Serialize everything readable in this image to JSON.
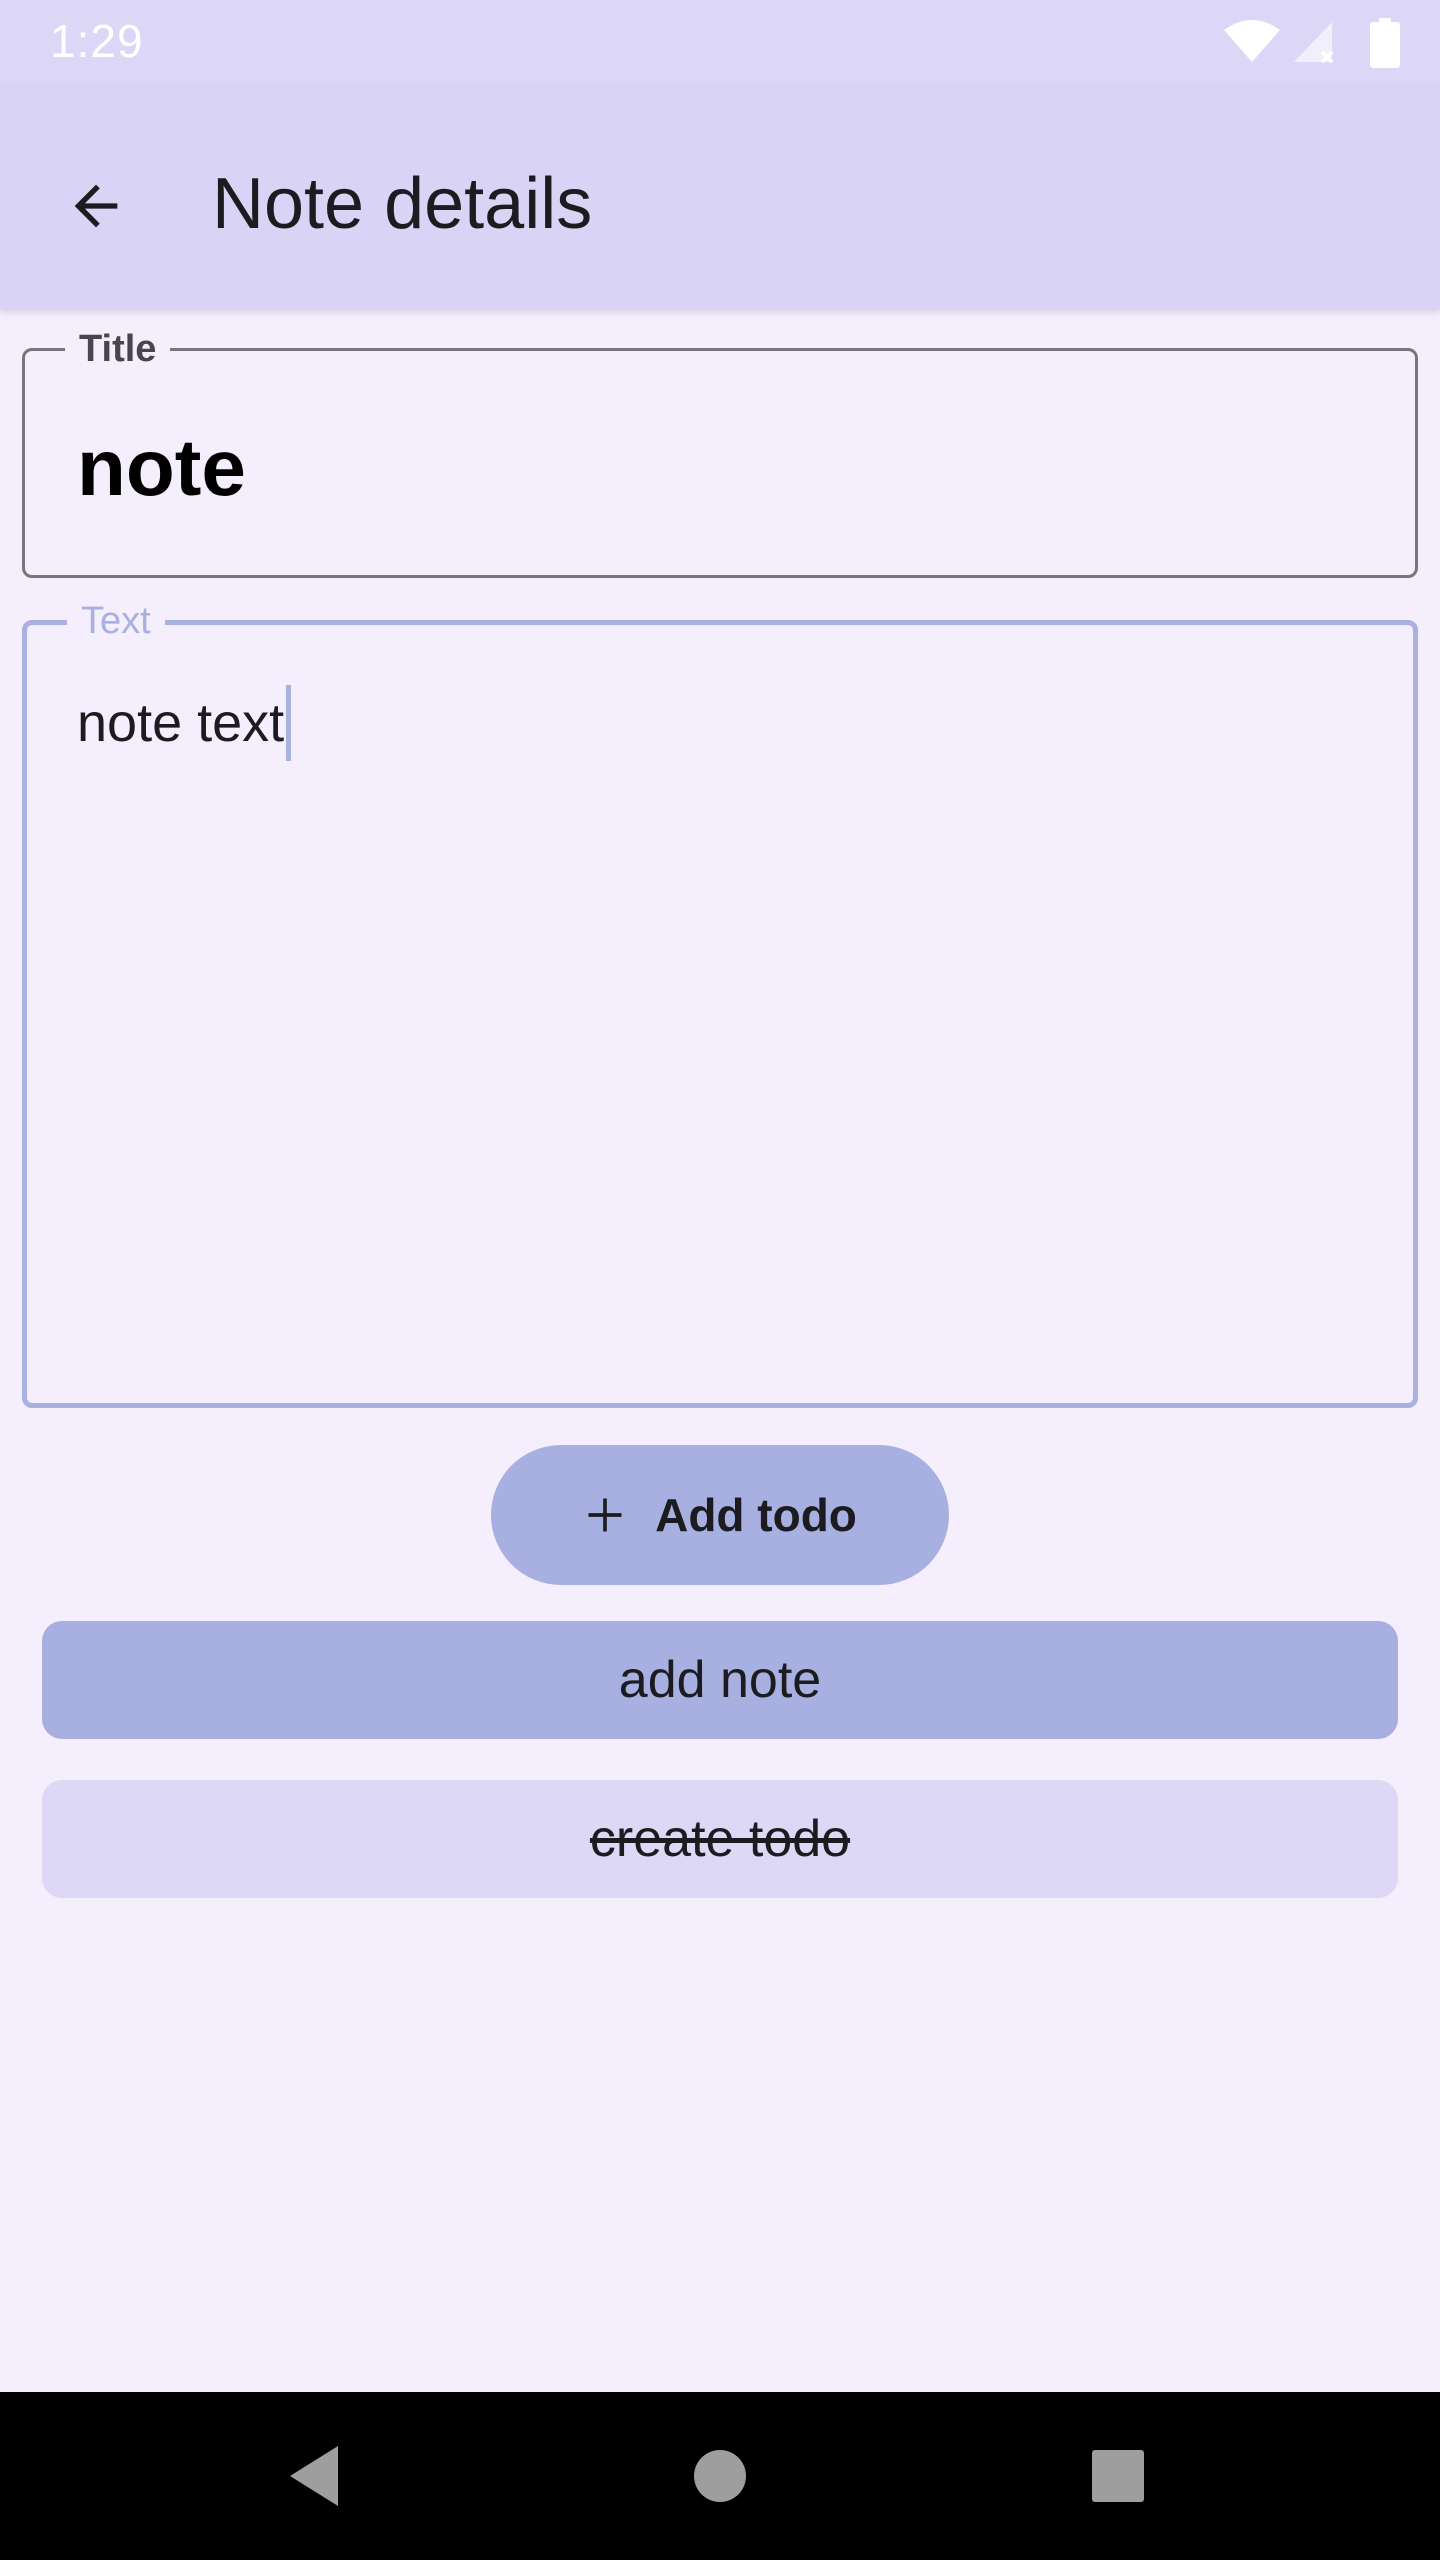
{
  "status_bar": {
    "time": "1:29",
    "icons": [
      "wifi-icon",
      "signal-icon",
      "battery-icon"
    ]
  },
  "app_bar": {
    "title": "Note details",
    "back_icon": "arrow-back-icon"
  },
  "form": {
    "title_field": {
      "label": "Title",
      "value": "note"
    },
    "text_field": {
      "label": "Text",
      "value": "note text"
    }
  },
  "actions": {
    "add_todo_label": "Add todo",
    "add_todo_icon": "plus-icon",
    "add_note_label": "add note",
    "create_todo_label": "create todo"
  },
  "navigation": {
    "buttons": [
      "back-nav-icon",
      "home-nav-icon",
      "recents-nav-icon"
    ]
  },
  "colors": {
    "background": "#f4eefd",
    "app_bar": "#d9d3f6",
    "accent": "#a7b0e0",
    "secondary_button": "#ddd8f6",
    "outline": "#79747e"
  }
}
